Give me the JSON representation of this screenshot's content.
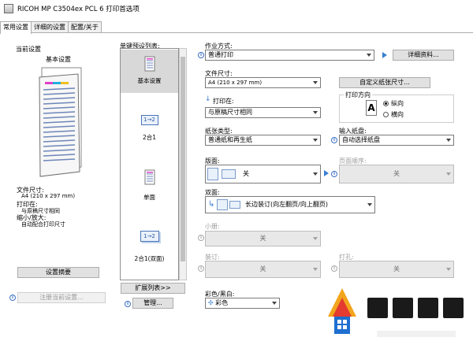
{
  "window": {
    "title": "RICOH MP C3504ex PCL 6 打印首选项"
  },
  "tabs": [
    "常用设置",
    "详细的设置",
    "配置/关于"
  ],
  "current_settings": {
    "heading": "当前设置",
    "name": "基本设置",
    "paper_size_label": "文件尺寸:",
    "paper_size_value": "A4 (210 x 297 mm)",
    "print_on_label": "打印在:",
    "print_on_value": "与原稿尺寸相同",
    "zoom_label": "缩小/放大:",
    "zoom_value": "自动配合打印尺寸",
    "summary_button": "设置摘要",
    "register_button": "注册当前设置..."
  },
  "presets": {
    "heading": "单键预设列表:",
    "items": [
      "基本设置",
      "2合1",
      "单面",
      "2合1(双面)"
    ],
    "expand_button": "扩展列表>>",
    "manage_button": "管理..."
  },
  "job": {
    "label": "作业方式:",
    "value": "普通打印",
    "details_button": "详细资料..."
  },
  "document_size": {
    "label": "文件尺寸:",
    "value": "A4 (210 x 297 mm)",
    "custom_button": "自定义纸张尺寸..."
  },
  "print_on": {
    "label": "打印在:",
    "value": "与原稿尺寸相同"
  },
  "orientation": {
    "label": "打印方向",
    "portrait": "纵向",
    "landscape": "横向"
  },
  "paper_type": {
    "label": "纸张类型:",
    "value": "普通纸和再生纸"
  },
  "input_tray": {
    "label": "输入纸盘:",
    "value": "自动选择纸盘"
  },
  "layout": {
    "label": "版面:",
    "value": "关"
  },
  "page_order": {
    "label": "页面顺序:",
    "value": "关"
  },
  "duplex": {
    "label": "双面:",
    "value": "长边装订(向左翻页/向上翻页)"
  },
  "booklet": {
    "label": "小册:",
    "value": "关"
  },
  "staple": {
    "label": "装订:",
    "value": "关"
  },
  "punch": {
    "label": "打孔:",
    "value": "关"
  },
  "color": {
    "label": "彩色/黑白:",
    "value": "彩色"
  },
  "icons": {
    "info": "info-icon",
    "play": "play-arrow-icon"
  },
  "colors": {
    "accent": "#3a7fd0",
    "selected_bg": "#d8d8d8",
    "tab_bg": "#f0f0f0"
  }
}
